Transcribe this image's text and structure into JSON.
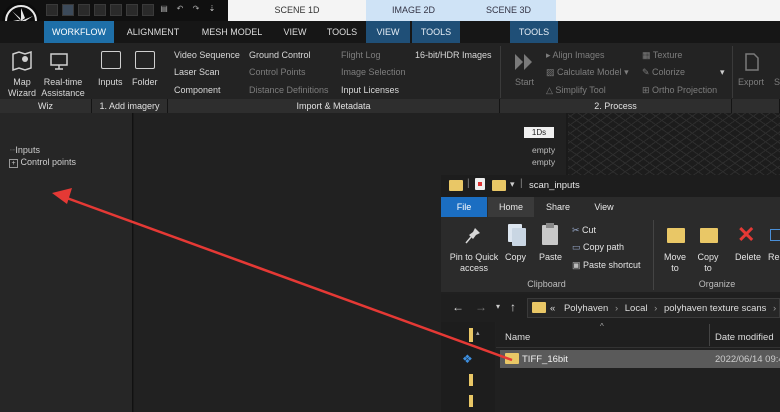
{
  "window": {
    "scene_tabs": [
      "SCENE 1D",
      "IMAGE 2D",
      "SCENE 3D"
    ],
    "menu": [
      "WORKFLOW",
      "ALIGNMENT",
      "MESH MODEL",
      "VIEW",
      "TOOLS",
      "VIEW",
      "TOOLS",
      "TOOLS"
    ]
  },
  "ribbon": {
    "wiz": {
      "map_wizard": "Map Wizard",
      "realtime": "Real-time Assistance",
      "label": "Wiz"
    },
    "add_imagery": {
      "inputs": "Inputs",
      "folder": "Folder",
      "label": "1. Add imagery"
    },
    "import": {
      "col1": [
        "Video Sequence",
        "Laser Scan",
        "Component"
      ],
      "col2": [
        "Ground Control",
        "Control Points",
        "Distance Definitions"
      ],
      "col3": [
        "Flight Log",
        "Image Selection",
        "Input Licenses"
      ],
      "col4": [
        "16-bit/HDR Images"
      ],
      "label": "Import & Metadata"
    },
    "process": {
      "start": "Start",
      "col1": [
        "Align Images",
        "Calculate Model",
        "Simplify Tool"
      ],
      "col2": [
        "Texture",
        "Colorize",
        "Ortho Projection"
      ],
      "label": "2. Process"
    },
    "export": {
      "export": "Export",
      "s": "S"
    }
  },
  "tree": {
    "inputs": "Inputs",
    "control_points": "Control points"
  },
  "viewport": {
    "badge": "1Ds",
    "empty1": "empty",
    "empty2": "empty"
  },
  "explorer": {
    "title": "scan_inputs",
    "tabs": [
      "File",
      "Home",
      "Share",
      "View"
    ],
    "clipboard": {
      "pin": "Pin to Quick access",
      "copy": "Copy",
      "paste": "Paste",
      "cut": "Cut",
      "copy_path": "Copy path",
      "paste_shortcut": "Paste shortcut",
      "label": "Clipboard"
    },
    "organize": {
      "move_to": "Move to",
      "copy_to": "Copy to",
      "delete": "Delete",
      "rename": "Re",
      "label": "Organize"
    },
    "breadcrumb": [
      "«",
      "Polyhaven",
      "Local",
      "polyhaven texture scans"
    ],
    "columns": {
      "name": "Name",
      "date": "Date modified"
    },
    "rows": [
      {
        "name": "TIFF_16bit",
        "date": "2022/06/14 09:4"
      }
    ]
  },
  "colors": {
    "workflow_tab": "#1e6fa8",
    "file_tab": "#1b6ec2",
    "arrow": "#e53935"
  }
}
